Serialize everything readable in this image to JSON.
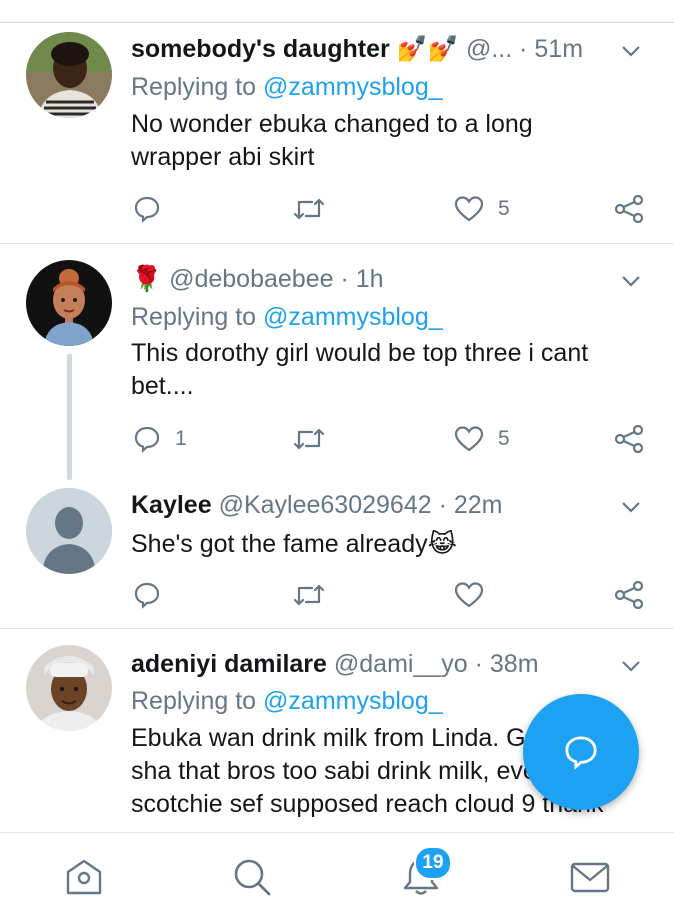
{
  "accent_color": "#1da1f2",
  "tweets": [
    {
      "name": "somebody's daughter",
      "emoji": "💅💅",
      "handle": "@...",
      "dot": "·",
      "time": "51m",
      "replying_prefix": "Replying to",
      "replying_to": "@zammysblog_",
      "text_lines": [
        "No wonder ebuka changed to a long",
        "wrapper abi skirt"
      ],
      "replies": "",
      "likes": "5"
    },
    {
      "name": "",
      "emoji": "🌹",
      "handle": "@debobaebee",
      "dot": "·",
      "time": "1h",
      "replying_prefix": "Replying to",
      "replying_to": "@zammysblog_",
      "text_lines": [
        "This dorothy girl would be top three i cant",
        "bet...."
      ],
      "replies": "1",
      "likes": "5"
    },
    {
      "name": "Kaylee",
      "handle": "@Kaylee63029642",
      "dot": "·",
      "time": "22m",
      "text_lines": [
        "She's got the fame already😹"
      ],
      "replies": "",
      "likes": ""
    },
    {
      "name": "adeniyi damilare",
      "handle": "@dami__yo",
      "dot": "·",
      "time": "38m",
      "replying_prefix": "Replying to",
      "replying_to": "@zammysblog_",
      "text_lines": [
        "Ebuka wan drink milk from Linda. G",
        "sha that bros too sabi drink milk, eve",
        "scotchie sef supposed reach cloud 9 thank"
      ]
    }
  ],
  "bottom_nav": {
    "items": [
      "home-icon",
      "search-icon",
      "notifications-icon",
      "messages-icon"
    ],
    "notification_count": "19"
  }
}
